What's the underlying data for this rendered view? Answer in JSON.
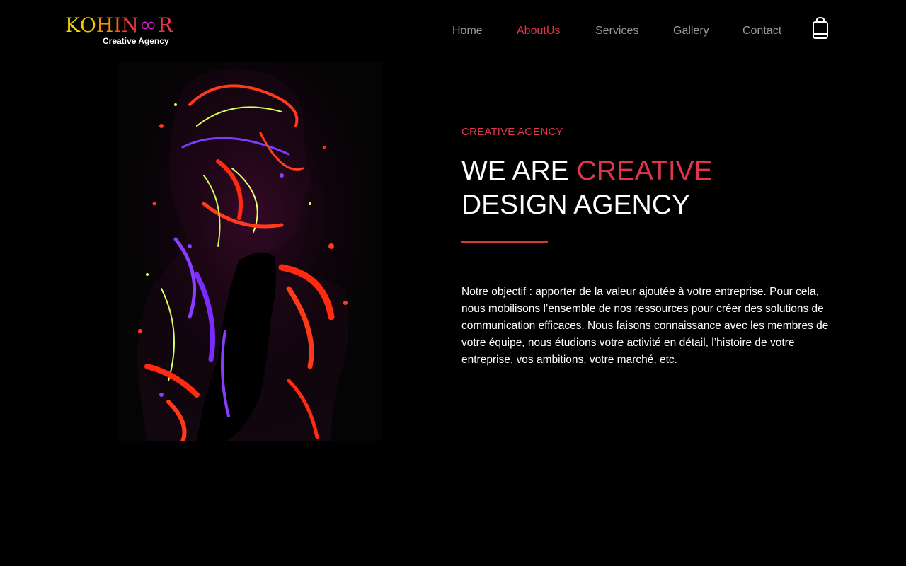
{
  "logo": {
    "letters": [
      {
        "char": "K",
        "color": "#f5d800"
      },
      {
        "char": "O",
        "color": "#f5c400"
      },
      {
        "char": "H",
        "color": "#f09000"
      },
      {
        "char": "I",
        "color": "#ee6010"
      },
      {
        "char": "N",
        "color": "#e83a3a"
      },
      {
        "char": "∞",
        "color": "#c81ec8"
      },
      {
        "char": "R",
        "color": "#e8364a"
      }
    ],
    "subtitle": "Creative Agency"
  },
  "nav": {
    "items": [
      {
        "label": "Home",
        "active": false
      },
      {
        "label": "AboutUs",
        "active": true
      },
      {
        "label": "Services",
        "active": false
      },
      {
        "label": "Gallery",
        "active": false
      },
      {
        "label": "Contact",
        "active": false
      }
    ],
    "cart_icon": "shopping-bag-icon"
  },
  "hero": {
    "eyebrow": "CREATIVE AGENCY",
    "headline_part1": "WE ARE ",
    "headline_accent": "CREATIVE",
    "headline_part2": "DESIGN AGENCY",
    "body": "Notre objectif : apporter de la valeur ajoutée à votre entreprise. Pour cela, nous mobilisons l’ensemble de nos ressources pour créer des solutions de communication efficaces. Nous faisons connaissance avec les membres de votre équipe, nous étudions votre activité en détail, l’histoire de votre entreprise, vos ambitions, votre marché, etc."
  },
  "colors": {
    "accent": "#e0364b",
    "nav_text": "#9a9a9a",
    "background": "#000000",
    "divider": "#d83a33"
  }
}
